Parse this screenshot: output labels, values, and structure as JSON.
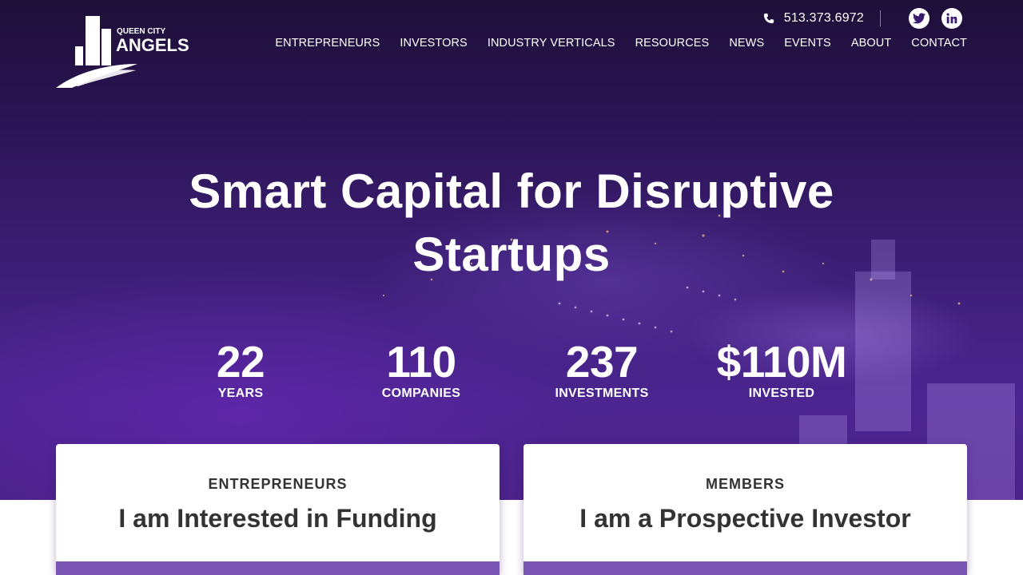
{
  "brand": {
    "logo_small": "QUEEN CITY",
    "logo_large": "ANGELS"
  },
  "topbar": {
    "phone": "513.373.6972",
    "phone_icon": "phone-icon",
    "social": [
      {
        "name": "twitter-icon"
      },
      {
        "name": "linkedin-icon"
      }
    ]
  },
  "nav": {
    "items": [
      {
        "label": "ENTREPRENEURS"
      },
      {
        "label": "INVESTORS"
      },
      {
        "label": "INDUSTRY VERTICALS"
      },
      {
        "label": "RESOURCES"
      },
      {
        "label": "NEWS"
      },
      {
        "label": "EVENTS"
      },
      {
        "label": "ABOUT"
      },
      {
        "label": "CONTACT"
      }
    ]
  },
  "hero": {
    "headline_line1": "Smart Capital for Disruptive",
    "headline_line2": "Startups"
  },
  "stats": [
    {
      "value": "22",
      "label": "YEARS"
    },
    {
      "value": "110",
      "label": "COMPANIES"
    },
    {
      "value": "237",
      "label": "INVESTMENTS"
    },
    {
      "value": "$110M",
      "label": "INVESTED"
    }
  ],
  "cards": [
    {
      "kicker": "ENTREPRENEURS",
      "title": "I am Interested in Funding"
    },
    {
      "kicker": "MEMBERS",
      "title": "I am a Prospective Investor"
    }
  ],
  "colors": {
    "hero_purple": "#3d1f78",
    "card_strip": "#7a55b4",
    "text_dark": "#333333"
  }
}
